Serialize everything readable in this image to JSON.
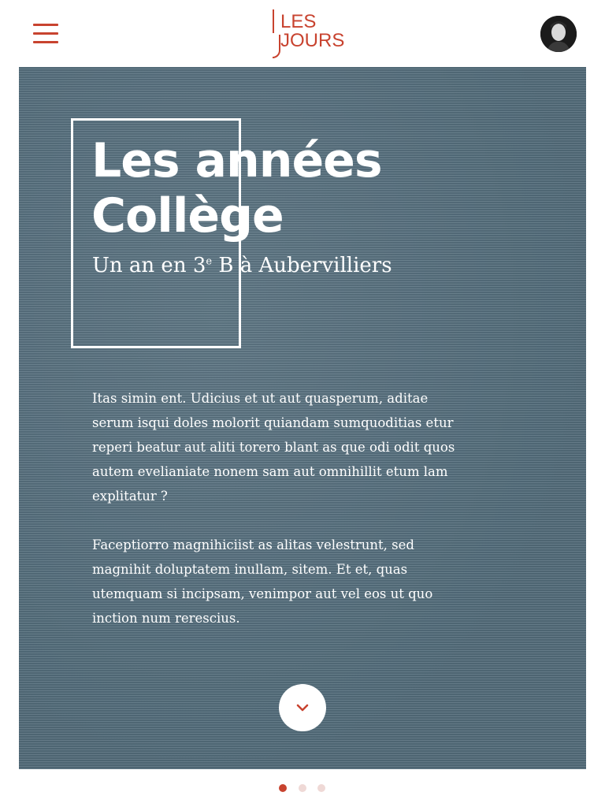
{
  "header": {
    "logo_line1": "LES",
    "logo_line2": "JOURS",
    "menu_icon": "hamburger-icon",
    "avatar_icon": "user-avatar"
  },
  "hero": {
    "title_line1": "Les années",
    "title_line2": "Collège",
    "subtitle_pre": "Un an en 3",
    "subtitle_sup": "e",
    "subtitle_post": " B à Aubervilliers",
    "paragraph1": "Itas simin ent. Udicius et ut aut quasperum, aditae serum isqui doles molorit quiandam sumquoditias etur reperi beatur aut aliti torero blant as que odi odit quos autem evelianiate nonem sam aut omnihillit etum lam explitatur ?",
    "paragraph2": "Faceptiorro magnihiciist as alitas velestrunt, sed magnihit doluptatem inullam, sitem. Et et, quas utemquam si incipsam, venimpor aut vel eos ut quo inction num rerescius.",
    "scroll_icon": "chevron-down-icon"
  },
  "pagination": {
    "count": 3,
    "active_index": 0
  },
  "colors": {
    "brand_red": "#c8432f",
    "hero_bg": "#56707f"
  }
}
